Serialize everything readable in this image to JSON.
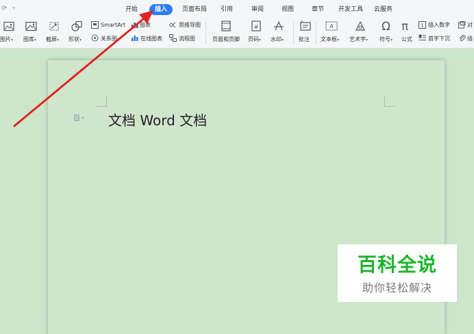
{
  "menu_tabs": {
    "start": "开始",
    "insert": "插入",
    "page_layout": "页面布局",
    "references": "引用",
    "review": "审阅",
    "view": "视图",
    "section": "章节",
    "dev_tools": "开发工具",
    "cloud": "云服务"
  },
  "ribbon": {
    "picture": "图片",
    "gallery": "图库",
    "screenshot": "截屏",
    "shape": "形状",
    "smartart": "SmartArt",
    "relation": "关系图",
    "chart": "图表",
    "online_chart": "在线图表",
    "mindmap": "思维导图",
    "flowchart": "流程图",
    "header_footer": "页眉和页脚",
    "page_number": "页码",
    "watermark": "水印",
    "comment": "批注",
    "textbox": "文本框",
    "wordart": "艺术字",
    "symbol": "符号",
    "formula": "公式",
    "insert_number": "插入数字",
    "dropcap": "首字下沉",
    "object": "对",
    "attach": "插"
  },
  "document": {
    "text": "文档 Word 文档"
  },
  "watermark": {
    "title": "百科全说",
    "subtitle": "助你轻松解决"
  },
  "colors": {
    "accent": "#2e7df0",
    "arrow": "#e02424",
    "watermark_green": "#1bb52a"
  }
}
